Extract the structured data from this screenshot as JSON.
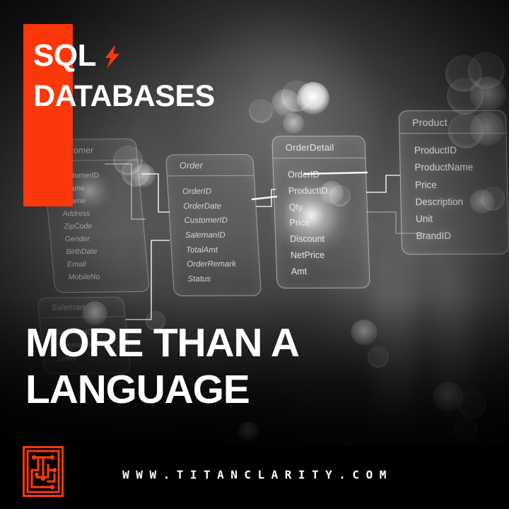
{
  "brand": {
    "accent_color": "#FA380B",
    "eyebrow_line1": "SQL",
    "eyebrow_line2": "DATABASES",
    "bolt_icon": "lightning-bolt-icon"
  },
  "headline": {
    "line1": "MORE THAN A",
    "line2": "LANGUAGE"
  },
  "footer": {
    "url": "WWW.TITANCLARITY.COM",
    "logo_name": "titanclarity-logo"
  },
  "diagram": {
    "type": "entity-relationship",
    "tables": [
      {
        "name": "Customer",
        "fields": [
          "CustomerID",
          "FName",
          "LName",
          "Address",
          "ZipCode",
          "Gender",
          "BirthDate",
          "Email",
          "MobileNo"
        ]
      },
      {
        "name": "Saleman",
        "fields": [
          "SalemanID",
          "SalemanName",
          "Level"
        ]
      },
      {
        "name": "Order",
        "fields": [
          "OrderID",
          "OrderDate",
          "CustomerID",
          "SalemanID",
          "TotalAmt",
          "OrderRemark",
          "Status"
        ]
      },
      {
        "name": "OrderDetail",
        "fields": [
          "OrderID",
          "ProductID",
          "Qty",
          "Price",
          "Discount",
          "NetPrice",
          "Amt"
        ]
      },
      {
        "name": "Product",
        "fields": [
          "ProductID",
          "ProductName",
          "Price",
          "Description",
          "Unit",
          "BrandID"
        ]
      }
    ]
  }
}
